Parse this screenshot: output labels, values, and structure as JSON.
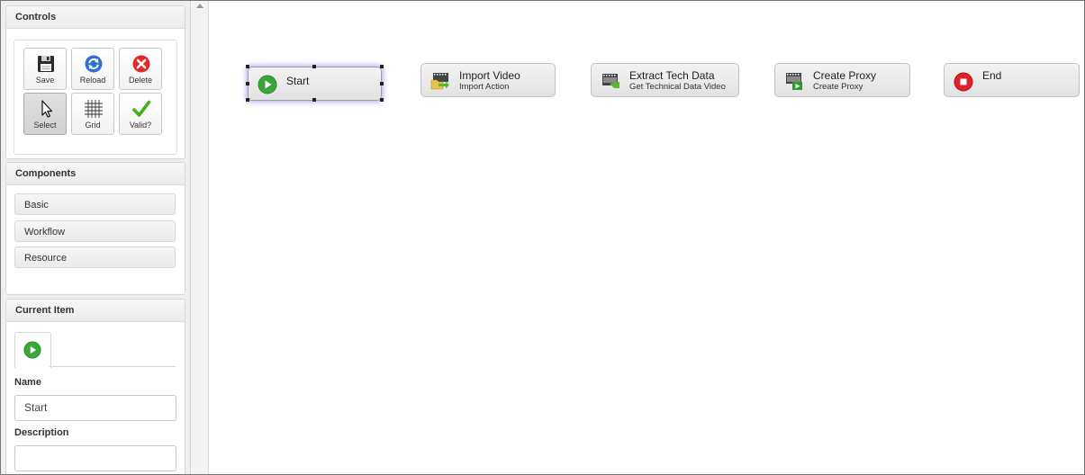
{
  "controls": {
    "title": "Controls",
    "buttons": [
      {
        "id": "save",
        "label": "Save",
        "icon": "save-icon"
      },
      {
        "id": "reload",
        "label": "Reload",
        "icon": "reload-icon"
      },
      {
        "id": "delete",
        "label": "Delete",
        "icon": "delete-icon"
      },
      {
        "id": "select",
        "label": "Select",
        "icon": "cursor-icon",
        "active": true
      },
      {
        "id": "grid",
        "label": "Grid",
        "icon": "grid-icon"
      },
      {
        "id": "valid",
        "label": "Valid?",
        "icon": "checkmark-icon"
      }
    ]
  },
  "components": {
    "title": "Components",
    "items": [
      {
        "label": "Basic"
      },
      {
        "label": "Workflow"
      },
      {
        "label": "Resource"
      }
    ]
  },
  "current_item": {
    "title": "Current Item",
    "tab_icon": "play-icon",
    "name_label": "Name",
    "name_value": "Start",
    "description_label": "Description",
    "description_value": ""
  },
  "workflow": {
    "nodes": [
      {
        "id": "start",
        "title": "Start",
        "subtitle": "",
        "icon": "play-icon",
        "selected": true
      },
      {
        "id": "import",
        "title": "Import Video",
        "subtitle": "Import Action",
        "icon": "film-import-icon"
      },
      {
        "id": "extract",
        "title": "Extract Tech Data",
        "subtitle": "Get Technical Data Video",
        "icon": "film-extract-icon"
      },
      {
        "id": "proxy",
        "title": "Create Proxy",
        "subtitle": "Create Proxy",
        "icon": "film-proxy-icon"
      },
      {
        "id": "end",
        "title": "End",
        "subtitle": "",
        "icon": "stop-icon"
      }
    ]
  },
  "colors": {
    "play_green": "#3aa63a",
    "stop_red": "#e0202b",
    "reload_blue": "#2f6fcf",
    "delete_red": "#e02a2a",
    "check_green": "#45b01f",
    "selection_glow": "#8282dc"
  }
}
